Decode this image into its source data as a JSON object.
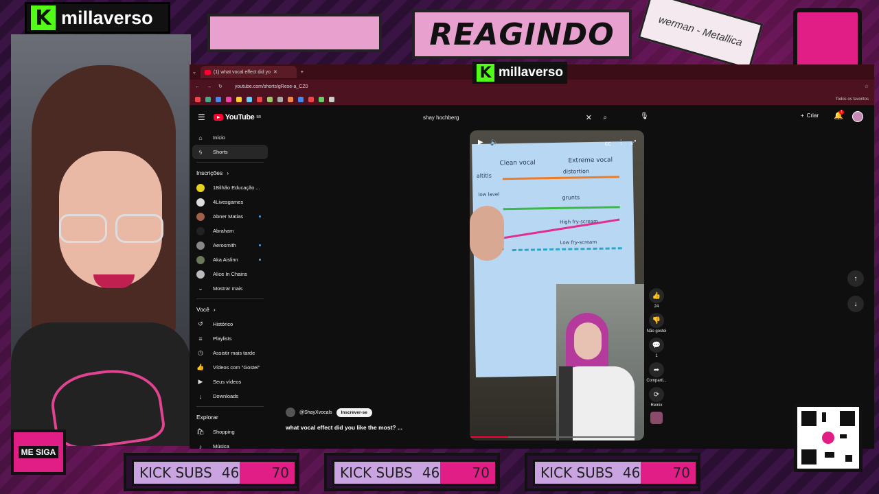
{
  "overlay": {
    "brand_name": "millaverso",
    "banner_title": "REAGINDO",
    "sticker_text": "werman - Metallica",
    "follow_label": "ME SIGA",
    "sub_bars": [
      {
        "label": "KICK SUBS",
        "current": "46",
        "goal": "70"
      },
      {
        "label": "KICK SUBS",
        "current": "46",
        "goal": "70"
      },
      {
        "label": "KICK SUBS",
        "current": "46",
        "goal": "70"
      }
    ]
  },
  "browser": {
    "tab_title": "(1) what vocal effect did yo",
    "url": "youtube.com/shorts/gRese-a_CZ0",
    "all_bookmarks": "Todos os favoritos"
  },
  "youtube": {
    "logo": "YouTube",
    "logo_sup": "BR",
    "search_value": "shay hochberg",
    "create_label": "Criar",
    "notif_count": "1",
    "sidebar": {
      "main": [
        {
          "icon": "home-icon",
          "glyph": "⌂",
          "label": "Início",
          "active": false
        },
        {
          "icon": "shorts-icon",
          "glyph": "ϟ",
          "label": "Shorts",
          "active": true
        }
      ],
      "subs_header": "Inscrições",
      "subs": [
        {
          "label": "1Bilhão Educação ...",
          "color": "#e6d21a",
          "live": false
        },
        {
          "label": "4Livesgames",
          "color": "#ddd",
          "live": false
        },
        {
          "label": "Abner Matias",
          "color": "#a0604a",
          "live": true
        },
        {
          "label": "Abraham",
          "color": "#222",
          "live": false
        },
        {
          "label": "Aerosmith",
          "color": "#888",
          "live": true
        },
        {
          "label": "Aka Aislinn",
          "color": "#6a7a5a",
          "live": true
        },
        {
          "label": "Alice In Chains",
          "color": "#bbb",
          "live": false
        }
      ],
      "show_more": "Mostrar mais",
      "you_header": "Você",
      "you": [
        {
          "icon": "history-icon",
          "glyph": "↺",
          "label": "Histórico"
        },
        {
          "icon": "playlists-icon",
          "glyph": "≡",
          "label": "Playlists"
        },
        {
          "icon": "watch-later-icon",
          "glyph": "◷",
          "label": "Assistir mais tarde"
        },
        {
          "icon": "liked-icon",
          "glyph": "👍",
          "label": "Vídeos com \"Gostei\""
        },
        {
          "icon": "your-videos-icon",
          "glyph": "▶",
          "label": "Seus vídeos"
        },
        {
          "icon": "downloads-icon",
          "glyph": "↓",
          "label": "Downloads"
        }
      ],
      "explore_header": "Explorar",
      "explore": [
        {
          "icon": "shopping-icon",
          "glyph": "🛍",
          "label": "Shopping"
        },
        {
          "icon": "music-icon",
          "glyph": "♪",
          "label": "Música"
        }
      ]
    },
    "short": {
      "channel": "@ShayXvocals",
      "subscribe": "Inscrever-se",
      "title": "what vocal effect did you like the most? ...",
      "paper": {
        "h1": "Clean vocal",
        "h2": "Extreme vocal",
        "r1l": "altitls",
        "r1r": "distortion",
        "r2l": "low lavel",
        "r2r": "grunts",
        "r3r": "High fry-scream",
        "r4l": "vocl",
        "r4r": "Low fry-scream"
      },
      "progress": 0.22,
      "actions": {
        "likes": "24",
        "dislike": "Não gostei",
        "comments": "1",
        "share": "Comparti...",
        "remix": "Remix"
      }
    }
  }
}
